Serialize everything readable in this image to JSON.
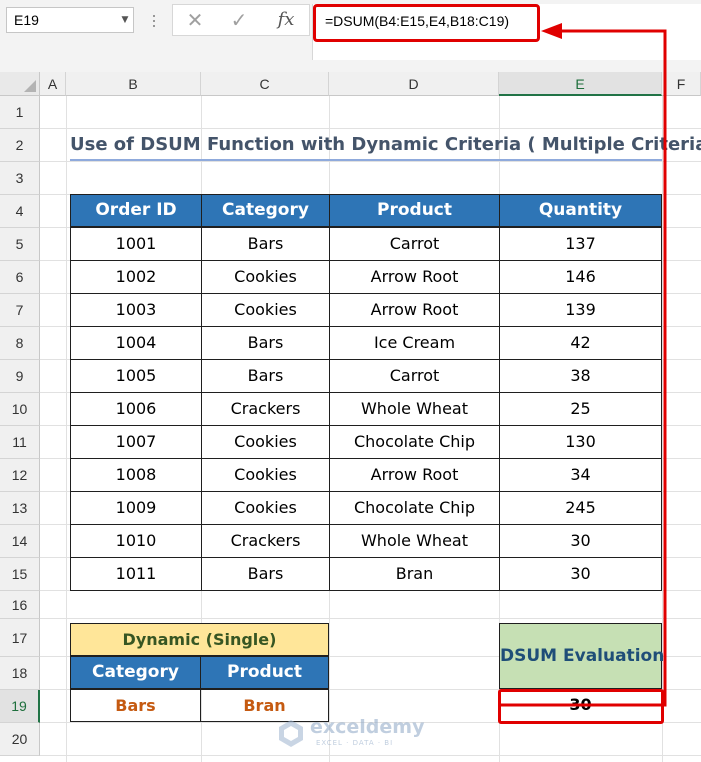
{
  "formula_bar": {
    "name_box": "E19",
    "cancel_icon": "✕",
    "enter_icon": "✓",
    "fx_label": "fx",
    "formula": "=DSUM(B4:E15,E4,B18:C19)"
  },
  "column_headers": [
    "A",
    "B",
    "C",
    "D",
    "E",
    "F"
  ],
  "row_headers": [
    "1",
    "2",
    "3",
    "4",
    "5",
    "6",
    "7",
    "8",
    "9",
    "10",
    "11",
    "12",
    "13",
    "14",
    "15",
    "16",
    "17",
    "18",
    "19",
    "20"
  ],
  "selection": {
    "column": "E",
    "row": "19"
  },
  "title": "Use of DSUM Function with Dynamic Criteria ( Multiple Criteria)",
  "main_table": {
    "headers": [
      "Order ID",
      "Category",
      "Product",
      "Quantity"
    ],
    "rows": [
      [
        "1001",
        "Bars",
        "Carrot",
        "137"
      ],
      [
        "1002",
        "Cookies",
        "Arrow Root",
        "146"
      ],
      [
        "1003",
        "Cookies",
        "Arrow Root",
        "139"
      ],
      [
        "1004",
        "Bars",
        "Ice Cream",
        "42"
      ],
      [
        "1005",
        "Bars",
        "Carrot",
        "38"
      ],
      [
        "1006",
        "Crackers",
        "Whole Wheat",
        "25"
      ],
      [
        "1007",
        "Cookies",
        "Chocolate Chip",
        "130"
      ],
      [
        "1008",
        "Cookies",
        "Arrow Root",
        "34"
      ],
      [
        "1009",
        "Cookies",
        "Chocolate Chip",
        "245"
      ],
      [
        "1010",
        "Crackers",
        "Whole Wheat",
        "30"
      ],
      [
        "1011",
        "Bars",
        "Bran",
        "30"
      ]
    ]
  },
  "criteria_table": {
    "title": "Dynamic (Single)",
    "headers": [
      "Category",
      "Product"
    ],
    "values": [
      "Bars",
      "Bran"
    ]
  },
  "evaluation": {
    "label": "DSUM Evaluation",
    "value": "30"
  },
  "watermark": {
    "brand": "exceldemy",
    "tagline": "EXCEL · DATA · BI"
  },
  "colors": {
    "header_blue": "#2e75b6",
    "highlight_red": "#e00000",
    "criteria_yellow": "#ffe699",
    "evaluation_green": "#c6e0b4",
    "criteria_value_orange": "#c55a11",
    "excel_green": "#217346"
  }
}
